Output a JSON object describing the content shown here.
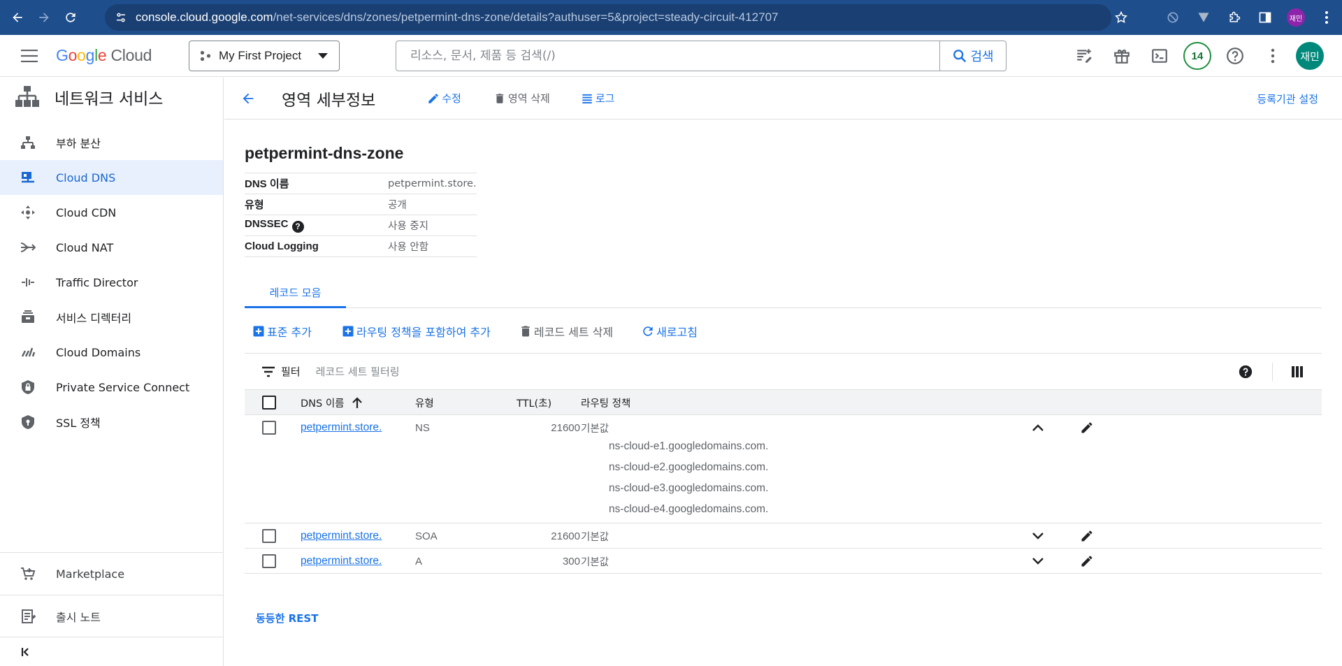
{
  "browser": {
    "url_host": "console.cloud.google.com",
    "url_path": "/net-services/dns/zones/petpermint-dns-zone/details?authuser=5&project=steady-circuit-412707",
    "profile_label": "재민"
  },
  "header": {
    "logo_google": [
      "G",
      "o",
      "o",
      "g",
      "l",
      "e"
    ],
    "logo_cloud": "Cloud",
    "project_name": "My First Project",
    "search_placeholder": "리소스, 문서, 제품 등 검색(/)",
    "search_button": "검색",
    "notification_count": "14",
    "avatar_label": "재민"
  },
  "sidebar": {
    "title": "네트워크 서비스",
    "items": [
      {
        "label": "부하 분산",
        "icon": "load-balancing-icon"
      },
      {
        "label": "Cloud DNS",
        "icon": "cloud-dns-icon",
        "active": true
      },
      {
        "label": "Cloud CDN",
        "icon": "cloud-cdn-icon"
      },
      {
        "label": "Cloud NAT",
        "icon": "cloud-nat-icon"
      },
      {
        "label": "Traffic Director",
        "icon": "traffic-director-icon"
      },
      {
        "label": "서비스 디렉터리",
        "icon": "service-directory-icon"
      },
      {
        "label": "Cloud Domains",
        "icon": "cloud-domains-icon"
      },
      {
        "label": "Private Service Connect",
        "icon": "private-service-connect-icon"
      },
      {
        "label": "SSL 정책",
        "icon": "ssl-policy-icon"
      }
    ],
    "bottom": [
      {
        "label": "Marketplace",
        "icon": "marketplace-icon"
      },
      {
        "label": "출시 노트",
        "icon": "release-notes-icon"
      }
    ],
    "collapse_label": "<|"
  },
  "page": {
    "title": "영역 세부정보",
    "actions": {
      "edit": "수정",
      "delete_zone": "영역 삭제",
      "logs": "로그"
    },
    "registrar_setup": "등록기관 설정",
    "zone_name": "petpermint-dns-zone",
    "info": {
      "dns_name_label": "DNS 이름",
      "dns_name_value": "petpermint.store.",
      "type_label": "유형",
      "type_value": "공개",
      "dnssec_label": "DNSSEC",
      "dnssec_value": "사용 중지",
      "logging_label": "Cloud Logging",
      "logging_value": "사용 안함"
    },
    "tab": "레코드 모음",
    "toolbar": {
      "add_standard": "표준 추가",
      "add_with_routing": "라우팅 정책을 포함하여 추가",
      "delete_record_sets": "레코드 세트 삭제",
      "refresh": "새로고침"
    },
    "filter": {
      "label": "필터",
      "placeholder": "레코드 세트 필터링"
    },
    "table": {
      "headers": {
        "dns_name": "DNS 이름",
        "type": "유형",
        "ttl": "TTL(초)",
        "routing_policy": "라우팅 정책"
      },
      "rows": [
        {
          "dns_name": "petpermint.store.",
          "type": "NS",
          "ttl": "21600",
          "policy": "기본값",
          "expanded": true,
          "data": [
            "ns-cloud-e1.googledomains.com.",
            "ns-cloud-e2.googledomains.com.",
            "ns-cloud-e3.googledomains.com.",
            "ns-cloud-e4.googledomains.com."
          ]
        },
        {
          "dns_name": "petpermint.store.",
          "type": "SOA",
          "ttl": "21600",
          "policy": "기본값",
          "expanded": false
        },
        {
          "dns_name": "petpermint.store.",
          "type": "A",
          "ttl": "300",
          "policy": "기본값",
          "expanded": false
        }
      ]
    },
    "rest_link": "동등한 REST"
  },
  "colors": {
    "chrome_bar": "#1f4e8c",
    "accent": "#1a73e8",
    "active_nav_bg": "#e8f0fe",
    "avatar": "#00897b",
    "badge_border": "#1e8e3e"
  }
}
